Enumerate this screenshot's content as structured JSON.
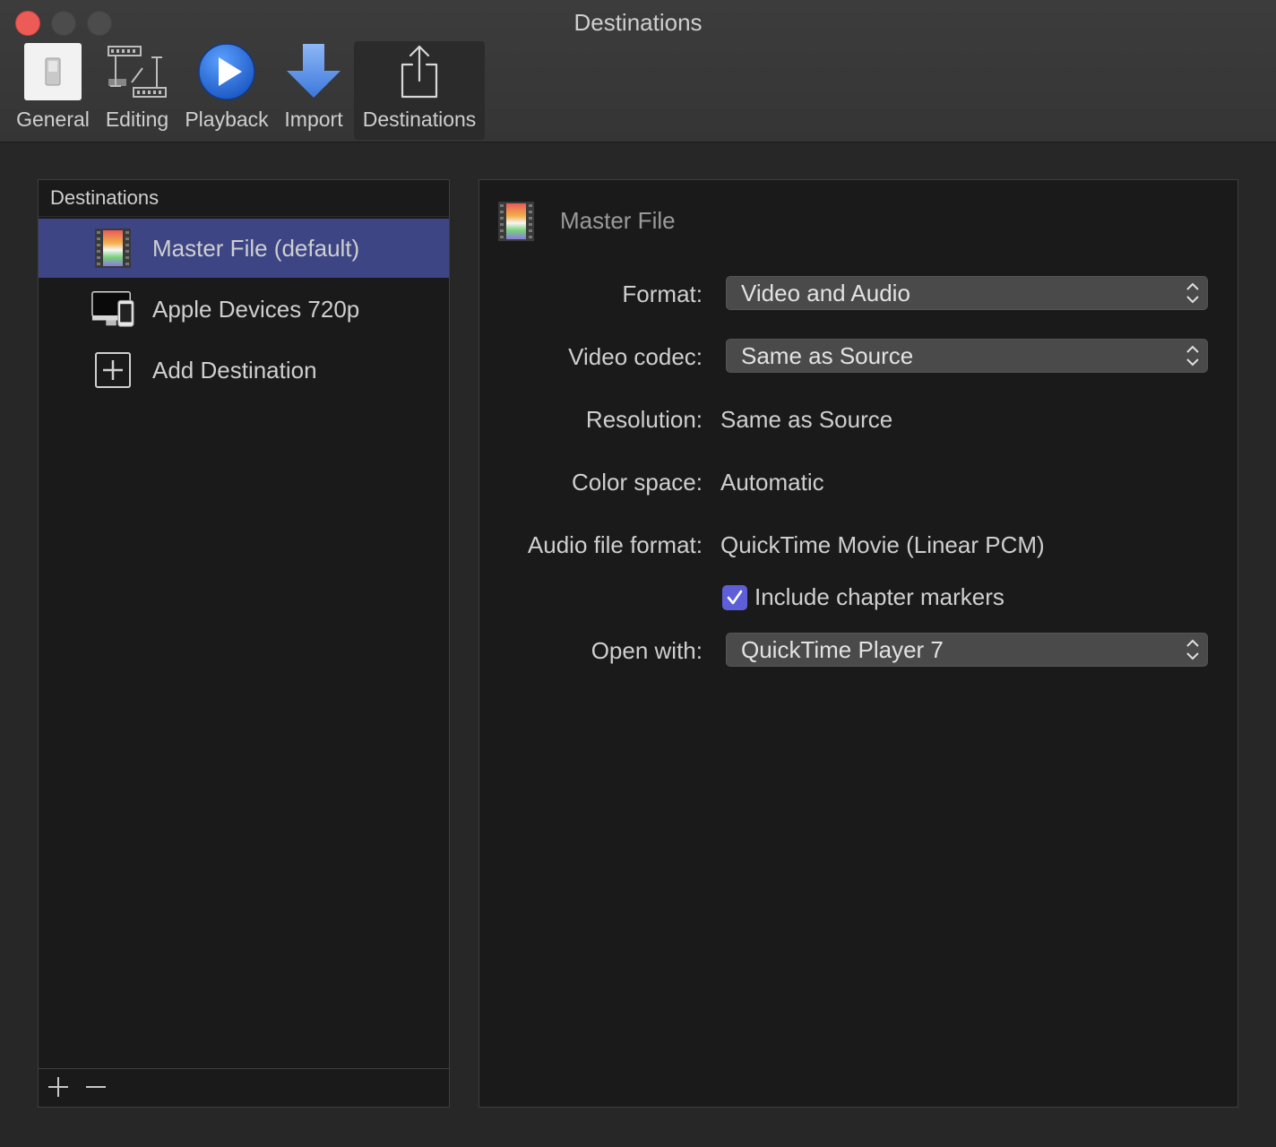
{
  "window": {
    "title": "Destinations"
  },
  "toolbar": {
    "items": [
      {
        "label": "General",
        "icon": "general-icon"
      },
      {
        "label": "Editing",
        "icon": "editing-icon"
      },
      {
        "label": "Playback",
        "icon": "playback-icon"
      },
      {
        "label": "Import",
        "icon": "import-icon"
      },
      {
        "label": "Destinations",
        "icon": "share-icon",
        "active": true
      }
    ]
  },
  "sidebar": {
    "header": "Destinations",
    "items": [
      {
        "label": "Master File (default)",
        "icon": "film-strip-icon",
        "selected": true
      },
      {
        "label": "Apple Devices 720p",
        "icon": "apple-devices-icon"
      },
      {
        "label": "Add Destination",
        "icon": "add-box-icon"
      }
    ],
    "footer": {
      "add": "+",
      "remove": "—"
    }
  },
  "detail": {
    "heading": "Master File",
    "format": {
      "label": "Format:",
      "value": "Video and Audio"
    },
    "video_codec": {
      "label": "Video codec:",
      "value": "Same as Source"
    },
    "resolution": {
      "label": "Resolution:",
      "value": "Same as Source"
    },
    "color_space": {
      "label": "Color space:",
      "value": "Automatic"
    },
    "audio_format": {
      "label": "Audio file format:",
      "value": "QuickTime Movie (Linear PCM)"
    },
    "chapter_markers": {
      "label": "Include chapter markers",
      "checked": true
    },
    "open_with": {
      "label": "Open with:",
      "value": "QuickTime Player 7"
    }
  },
  "colors": {
    "selection": "#3d4585",
    "checkbox": "#5e5ed8",
    "close": "#ec5b55",
    "accent_blue": "#2d6fd6"
  }
}
